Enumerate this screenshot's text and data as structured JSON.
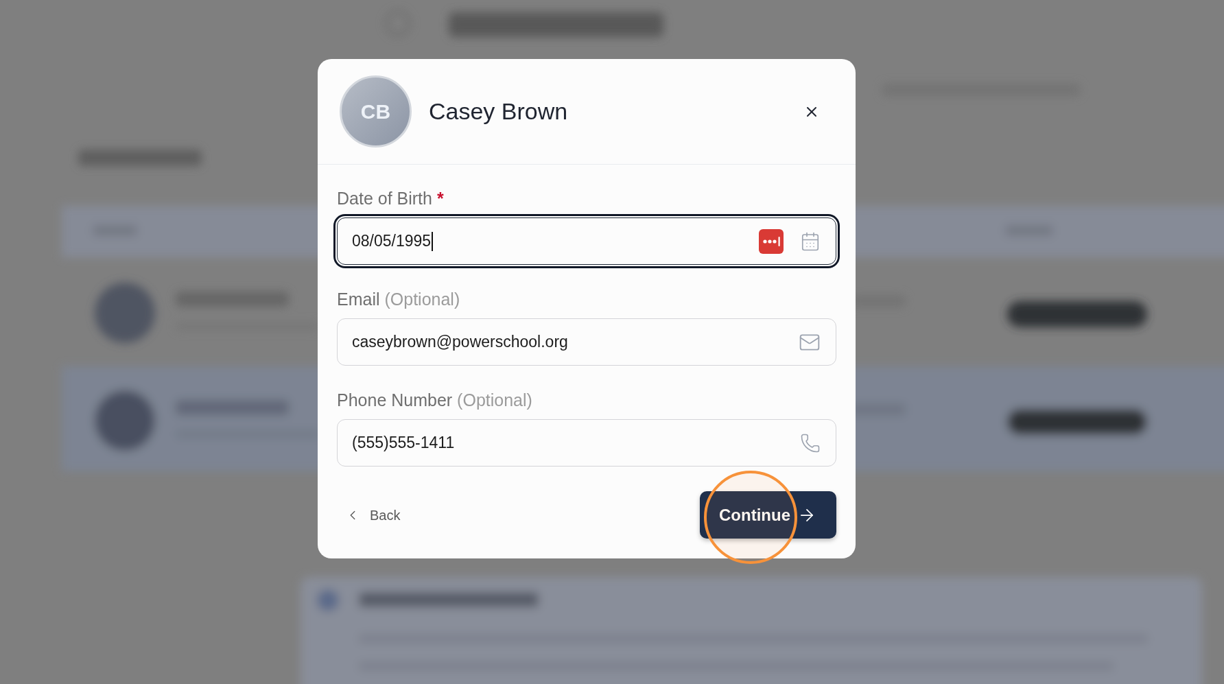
{
  "dialog": {
    "avatar": {
      "initials": "CB"
    },
    "title": "Casey Brown",
    "fields": [
      {
        "kind": "date",
        "label": "Date of Birth",
        "required_mark": "*",
        "value": "08/05/1995",
        "focused": true,
        "autofill_badge": true
      },
      {
        "kind": "email",
        "label": "Email",
        "qualifier": "(Optional)",
        "value": "caseybrown@powerschool.org",
        "focused": false
      },
      {
        "kind": "phone",
        "label": "Phone Number",
        "qualifier": "(Optional)",
        "value": "(555)555-1411",
        "focused": false
      }
    ],
    "buttons": [
      {
        "kind": "back",
        "label": "Back"
      },
      {
        "kind": "continue",
        "label": "Continue",
        "highlighted": true
      }
    ]
  }
}
